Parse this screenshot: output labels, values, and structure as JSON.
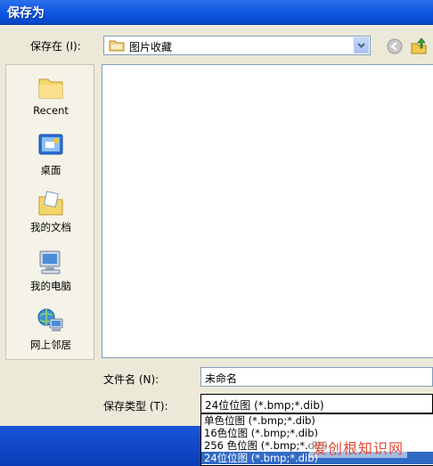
{
  "window": {
    "title": "保存为"
  },
  "save_in": {
    "label": "保存在 (I):",
    "current": "图片收藏"
  },
  "places": [
    {
      "label": "Recent",
      "icon": "recent-folder-icon"
    },
    {
      "label": "桌面",
      "icon": "desktop-icon"
    },
    {
      "label": "我的文档",
      "icon": "my-documents-icon"
    },
    {
      "label": "我的电脑",
      "icon": "my-computer-icon"
    },
    {
      "label": "网上邻居",
      "icon": "network-icon"
    }
  ],
  "filename": {
    "label": "文件名 (N):",
    "value": "未命名"
  },
  "filetype": {
    "label": "保存类型 (T):",
    "value": "24位位图 (*.bmp;*.dib)",
    "options": [
      "单色位图 (*.bmp;*.dib)",
      "16色位图 (*.bmp;*.dib)",
      "256 色位图 (*.bmp;*.dib)",
      "24位位图 (*.bmp;*.dib)"
    ],
    "selected_index": 3
  },
  "watermark": "爱创根知识网",
  "colors": {
    "title_bar": "#0A53DE",
    "dialog_bg": "#ECE9D8",
    "selection": "#316AC5"
  }
}
